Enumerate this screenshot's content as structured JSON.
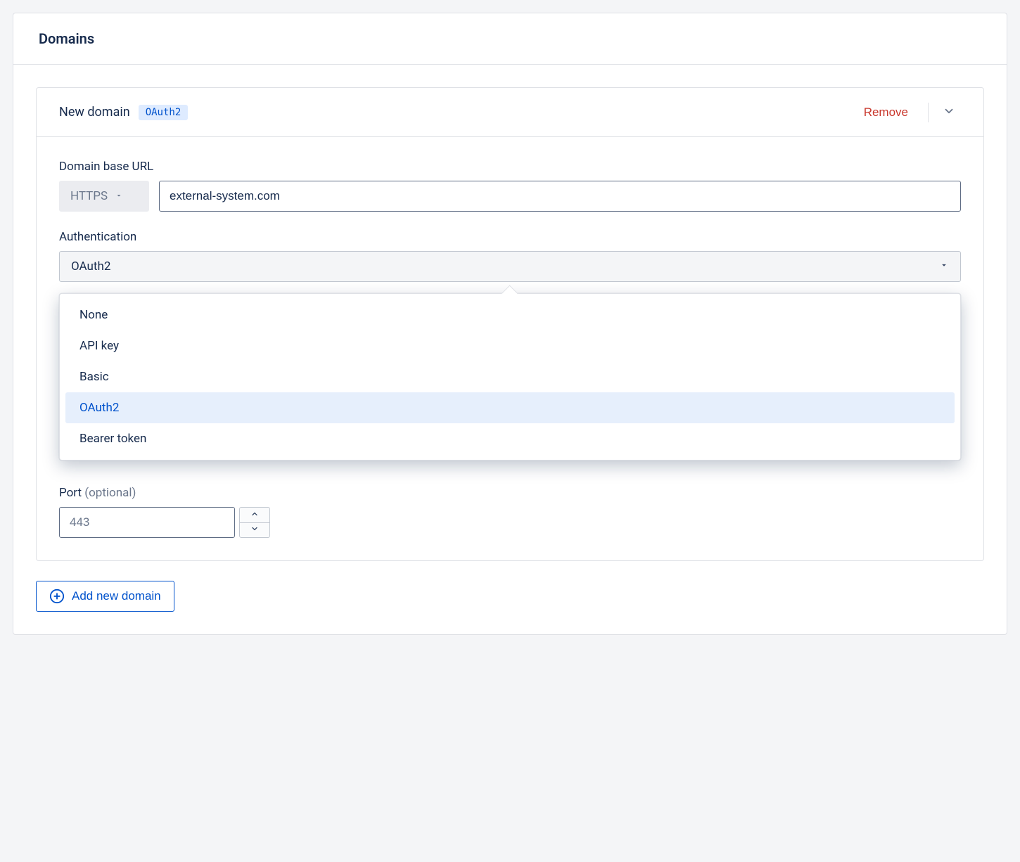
{
  "panel": {
    "title": "Domains"
  },
  "domain": {
    "title": "New domain",
    "badge": "OAuth2",
    "remove_label": "Remove"
  },
  "url": {
    "label": "Domain base URL",
    "scheme": "HTTPS",
    "value": "external-system.com"
  },
  "auth": {
    "label": "Authentication",
    "selected": "OAuth2",
    "options": [
      "None",
      "API key",
      "Basic",
      "OAuth2",
      "Bearer token"
    ]
  },
  "port": {
    "label": "Port ",
    "label_optional": "(optional)",
    "value": "443"
  },
  "add_button": "Add new domain"
}
